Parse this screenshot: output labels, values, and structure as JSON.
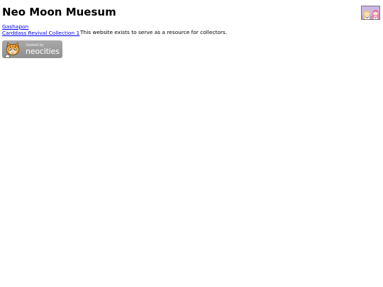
{
  "site": {
    "title": "Neo Moon Muesum"
  },
  "header": {
    "image_icon": "anime-character-thumbnail"
  },
  "nav": {
    "links": [
      {
        "label": "Gashapon"
      },
      {
        "label": "Carddass Revival Collection 1"
      }
    ]
  },
  "main": {
    "intro_text": "This website exists to serve as a resource for collectors."
  },
  "badge": {
    "small_text": "hosted by",
    "big_text": "neocities",
    "icon": "neocities-cat-icon",
    "background_color": "#9b9b9b"
  },
  "colors": {
    "link": "#0000ee",
    "text": "#000000",
    "background": "#ffffff"
  }
}
